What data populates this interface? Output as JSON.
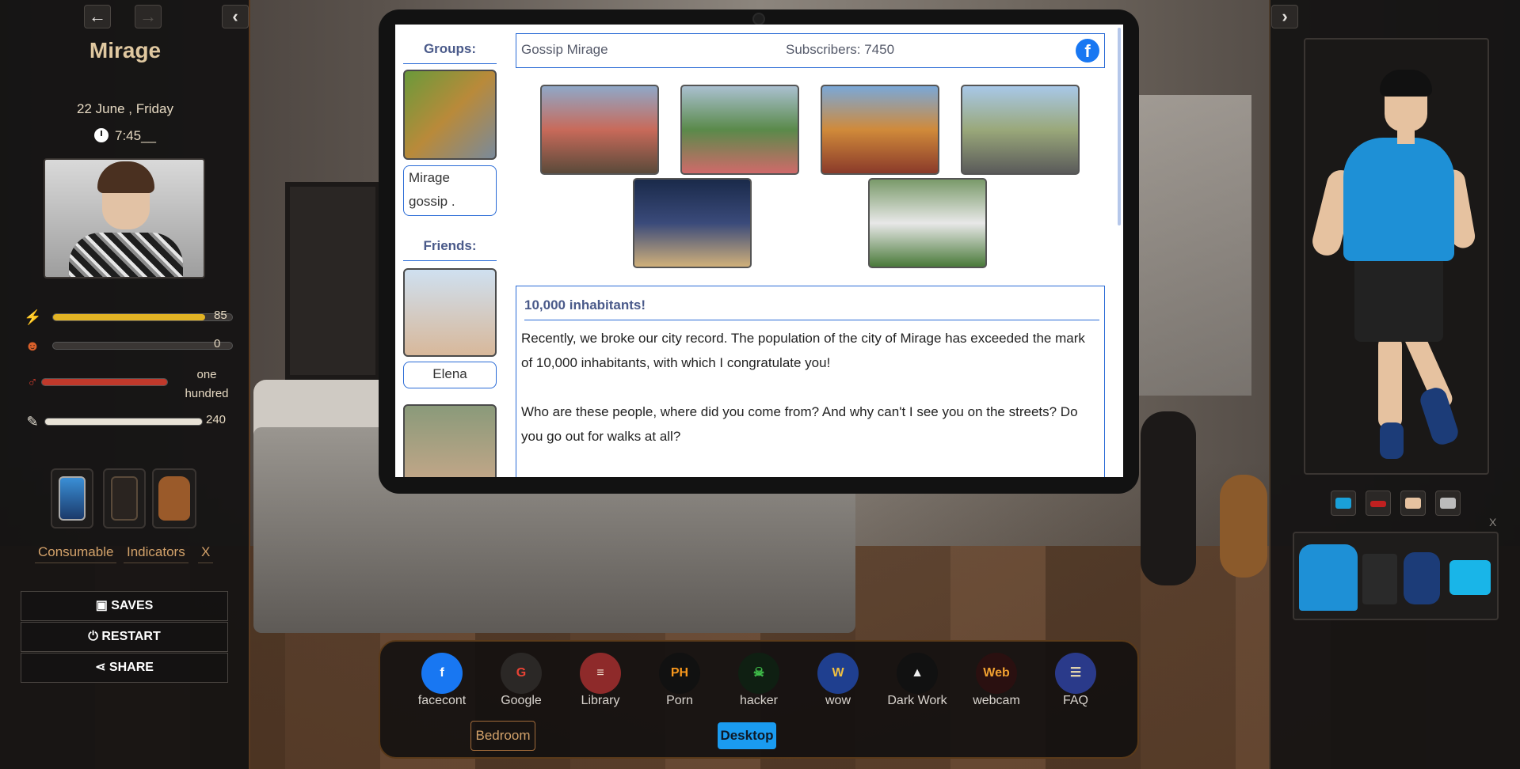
{
  "left_panel": {
    "player_name": "Mirage",
    "date": "22 June , Friday",
    "time": "7:45__",
    "stats": [
      {
        "icon": "lightning-icon",
        "value": "85",
        "fill": 0.85,
        "color": "#e2b324"
      },
      {
        "icon": "mood-face-icon",
        "value": "0",
        "fill": 0.0,
        "color": "#888888"
      },
      {
        "icon": "libido-icon",
        "value_line1": "one",
        "value_line2": "hundred",
        "fill": 1.0,
        "color": "#c0392b"
      },
      {
        "icon": "syringe-icon",
        "value": "240",
        "fill": 1.0,
        "color": "#e8e2d6"
      }
    ],
    "inventory": [
      "phone-icon",
      "notebook-icon",
      "backpack-icon"
    ],
    "tabs": {
      "consumable": "Consumable",
      "indicators": "Indicators",
      "close": "X"
    },
    "menu": {
      "saves": "SAVES",
      "restart": "RESTART",
      "share": "SHARE"
    }
  },
  "navigation": {
    "back": "←",
    "forward": "→",
    "collapse_left": "‹",
    "expand_right": "›"
  },
  "social": {
    "groups_heading": "Groups:",
    "group_label_line1": "Mirage",
    "group_label_line2": "gossip .",
    "friends_heading": "Friends:",
    "friend_name": "Elena",
    "page_name": "Gossip Mirage",
    "subscribers": "Subscribers: 7450",
    "fb_glyph": "f",
    "post": {
      "title": "10,000 inhabitants!",
      "para1": "Recently, we broke our city record. The population of the city of Mirage has exceeded the mark of 10,000 inhabitants, with which I congratulate you!",
      "para2": "Who are these people, where did you come from? And why can't I see you on the streets? Do you go out for walks at all?"
    }
  },
  "dock": {
    "apps": [
      {
        "name": "facecont",
        "icon": "facebook-icon",
        "glyph": "f",
        "bg": "#1877f2",
        "fg": "#ffffff"
      },
      {
        "name": "Google",
        "icon": "google-icon",
        "glyph": "G",
        "bg": "#2b2826",
        "fg": "#ea4335"
      },
      {
        "name": "Library",
        "icon": "books-icon",
        "glyph": "≡",
        "bg": "#8e2a2a",
        "fg": "#f0e0d0"
      },
      {
        "name": "Porn",
        "icon": "porn-hub-icon",
        "glyph": "PH",
        "bg": "#111111",
        "fg": "#f7971d"
      },
      {
        "name": "hacker",
        "icon": "hacker-skull-icon",
        "glyph": "☠",
        "bg": "#0f1f12",
        "fg": "#3fbf4a"
      },
      {
        "name": "wow",
        "icon": "warcraft-icon",
        "glyph": "W",
        "bg": "#1f3f8f",
        "fg": "#f0c040"
      },
      {
        "name": "Dark Work",
        "icon": "spy-icon",
        "glyph": "▲",
        "bg": "#111111",
        "fg": "#f0f0f0"
      },
      {
        "name": "webcam",
        "icon": "webcam-icon",
        "glyph": "Web",
        "bg": "#2a1010",
        "fg": "#f0a030"
      },
      {
        "name": "FAQ",
        "icon": "faq-scroll-icon",
        "glyph": "☰",
        "bg": "#2a3a8a",
        "fg": "#f0e0b0"
      }
    ],
    "bedroom": "Bedroom",
    "desktop": "Desktop"
  },
  "wardrobe": {
    "close": "X"
  }
}
